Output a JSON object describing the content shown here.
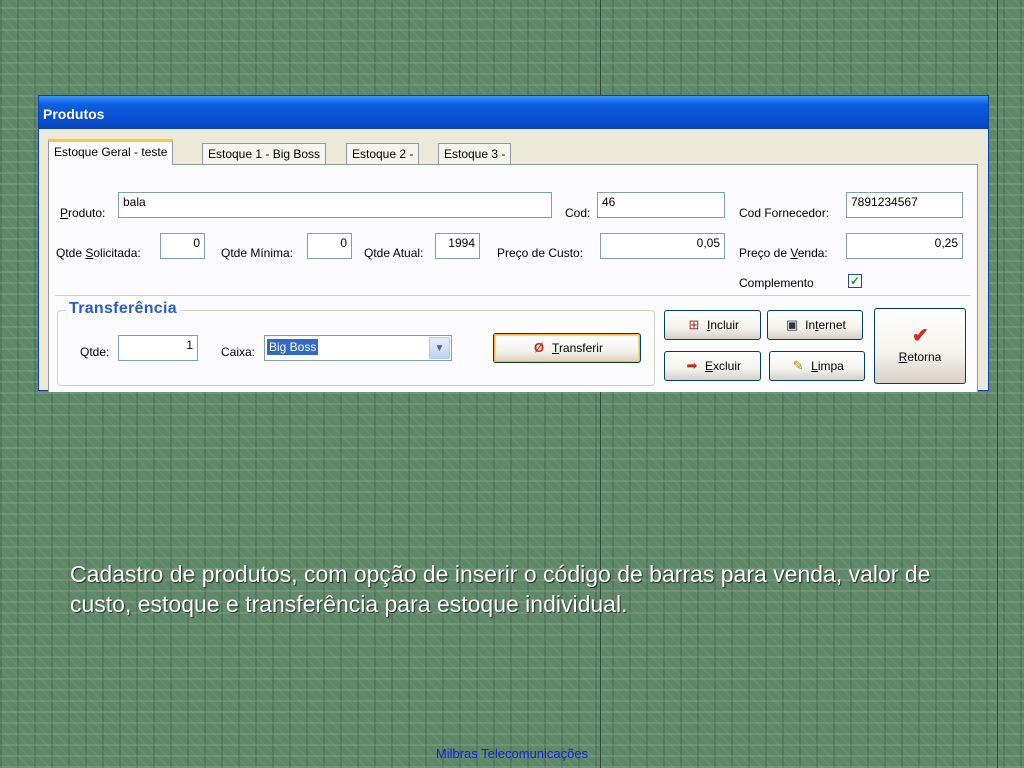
{
  "window": {
    "title": "Produtos"
  },
  "tabs": [
    {
      "label": "Estoque Geral - teste",
      "active": true
    },
    {
      "label": "Estoque 1 - Big Boss",
      "active": false
    },
    {
      "label": "Estoque 2 -",
      "active": false
    },
    {
      "label": "Estoque 3 -",
      "active": false
    }
  ],
  "form": {
    "produto": {
      "label_u": "P",
      "label_rest": "roduto:",
      "value": "bala"
    },
    "cod": {
      "label": "Cod:",
      "value": "46"
    },
    "cod_fornecedor": {
      "label": "Cod Fornecedor:",
      "value": "7891234567"
    },
    "qtde_solicitada": {
      "label_pre": "Qtde ",
      "label_u": "S",
      "label_rest": "olicitada:",
      "value": "0"
    },
    "qtde_minima": {
      "label": "Qtde Mínima:",
      "value": "0"
    },
    "qtde_atual": {
      "label": "Qtde Atual:",
      "value": "1994"
    },
    "preco_custo": {
      "label": "Preço de Custo:",
      "value": "0,05"
    },
    "preco_venda": {
      "label_pre": "Preço de ",
      "label_u": "V",
      "label_rest": "enda:",
      "value": "0,25"
    },
    "complemento": {
      "label": "Complemento",
      "checked": true,
      "mark": "✓"
    }
  },
  "transferencia": {
    "title": "Transferência",
    "qtde": {
      "label": "Qtde:",
      "value": "1"
    },
    "caixa": {
      "label": "Caixa:",
      "selected": "Big Boss"
    },
    "transferir": {
      "label_u": "T",
      "label_rest": "ransferir"
    }
  },
  "buttons": {
    "incluir": {
      "label_u": "I",
      "label_rest": "ncluir"
    },
    "internet": {
      "label_pre": "In",
      "label_u": "t",
      "label_rest": "ernet"
    },
    "excluir": {
      "label_u": "E",
      "label_rest": "xcluir"
    },
    "limpa": {
      "label_u": "L",
      "label_rest": "impa"
    },
    "retorna": {
      "label_u": "R",
      "label_rest": "etorna"
    }
  },
  "caption": "Cadastro de produtos, com opção de inserir o código  de  barras  para venda, valor de custo, estoque e transferência para estoque individual.",
  "footer": "Milbras Telecomunicações",
  "colors": {
    "titlebar": "#0a4fd0",
    "window_bg": "#ece9d8",
    "background": "#5f8868",
    "caption": "#ffffff",
    "footer": "#0f1fd8"
  }
}
